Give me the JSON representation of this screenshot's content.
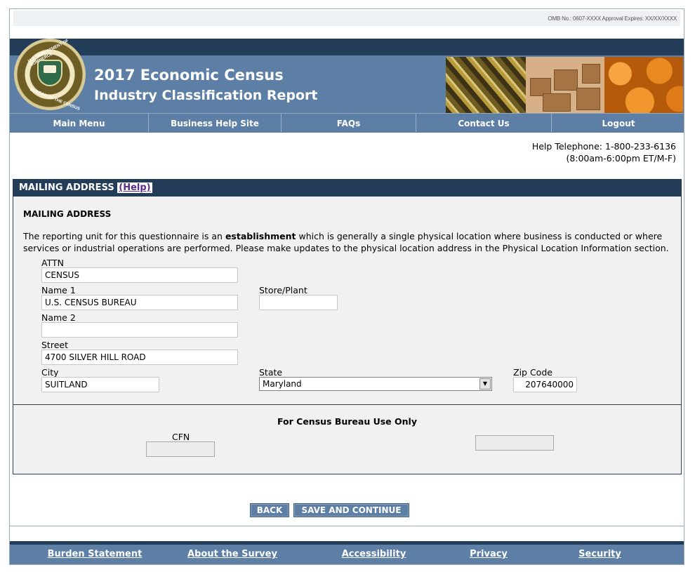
{
  "omb": "OMB No.: 0607-XXXX  Approval Expires: XX/XX/XXXX",
  "seal": {
    "top_text": "U.S. DEPARTMENT OF COMMERCE",
    "bottom_text": "BUREAU OF THE CENSUS"
  },
  "header": {
    "title_line1": "2017 Economic Census",
    "title_line2": "Industry Classification Report"
  },
  "nav": [
    "Main Menu",
    "Business Help Site",
    "FAQs",
    "Contact Us",
    "Logout"
  ],
  "help": {
    "telephone": "Help Telephone: 1-800-233-6136",
    "hours": "(8:00am-6:00pm ET/M-F)"
  },
  "section": {
    "heading": "MAILING ADDRESS",
    "help_link": "(Help)",
    "subtitle": "MAILING ADDRESS",
    "desc_before": "The reporting unit for this questionnaire is an ",
    "desc_bold": "establishment",
    "desc_after": " which is generally a single physical location where business is conducted or where services or industrial operations are performed.  Please make updates to the physical location address in the Physical Location Information section."
  },
  "form": {
    "attn_label": "ATTN",
    "attn_value": "CENSUS",
    "name1_label": "Name 1",
    "name1_value": "U.S. CENSUS BUREAU",
    "name2_label": "Name 2",
    "name2_value": "",
    "store_label": "Store/Plant",
    "store_value": "",
    "street_label": "Street",
    "street_value": "4700 SILVER HILL ROAD",
    "city_label": "City",
    "city_value": "SUITLAND",
    "state_label": "State",
    "state_value": "Maryland",
    "zip_label": "Zip Code",
    "zip_value": "207640000"
  },
  "census_use": {
    "heading": "For Census Bureau Use Only",
    "cfn_label": "CFN",
    "cfn_value": "",
    "other_value": ""
  },
  "buttons": {
    "back": "BACK",
    "save": "SAVE AND CONTINUE"
  },
  "footer": [
    "Burden Statement",
    "About the Survey",
    "Accessibility",
    "Privacy",
    "Security"
  ],
  "colors": {
    "navy": "#233c58",
    "steel_blue": "#5d7fa6",
    "link_purple": "#5a2c8f"
  }
}
